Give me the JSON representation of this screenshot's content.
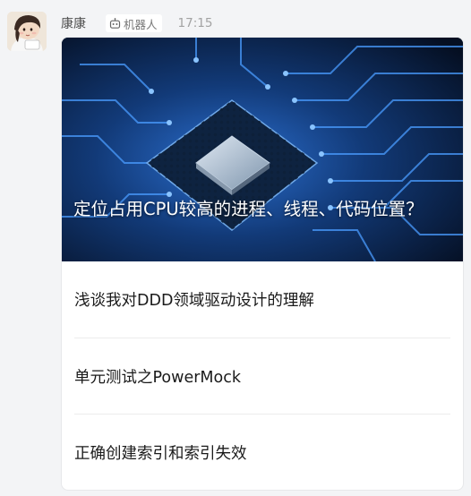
{
  "message": {
    "sender": "康康",
    "badge_label": "机器人",
    "time": "17:15"
  },
  "card": {
    "cover_title": "定位占用CPU较高的进程、线程、代码位置？",
    "articles": [
      {
        "title": "浅谈我对DDD领域驱动设计的理解"
      },
      {
        "title": "单元测试之PowerMock"
      },
      {
        "title": "正确创建索引和索引失效"
      }
    ]
  },
  "colors": {
    "background": "#f3f4f6",
    "card": "#ffffff",
    "circuit_blue": "#2f7fe0"
  }
}
